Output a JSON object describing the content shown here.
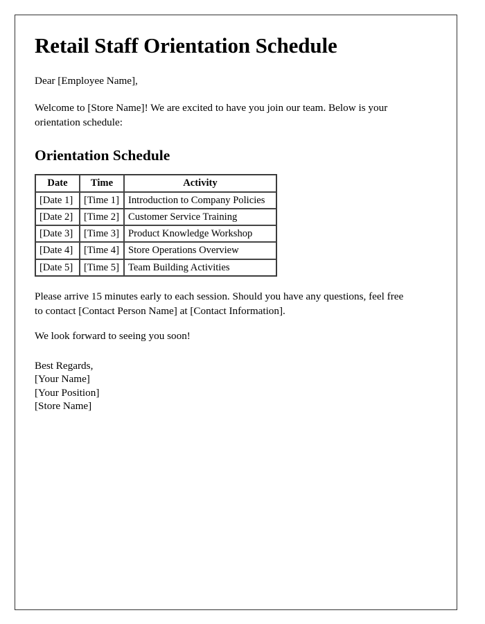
{
  "document": {
    "title": "Retail Staff Orientation Schedule",
    "salutation": "Dear [Employee Name],",
    "intro": "Welcome to [Store Name]! We are excited to have you join our team. Below is your orientation schedule:",
    "section_title": "Orientation Schedule",
    "note": "Please arrive 15 minutes early to each session. Should you have any questions, feel free to contact [Contact Person Name] at [Contact Information].",
    "closing": "We look forward to seeing you soon!",
    "signature": {
      "regards": "Best Regards,",
      "name": "[Your Name]",
      "position": "[Your Position]",
      "store": "[Store Name]"
    }
  },
  "schedule_table": {
    "headers": {
      "date": "Date",
      "time": "Time",
      "activity": "Activity"
    },
    "rows": [
      {
        "date": "[Date 1]",
        "time": "[Time 1]",
        "activity": "Introduction to Company Policies"
      },
      {
        "date": "[Date 2]",
        "time": "[Time 2]",
        "activity": "Customer Service Training"
      },
      {
        "date": "[Date 3]",
        "time": "[Time 3]",
        "activity": "Product Knowledge Workshop"
      },
      {
        "date": "[Date 4]",
        "time": "[Time 4]",
        "activity": "Store Operations Overview"
      },
      {
        "date": "[Date 5]",
        "time": "[Time 5]",
        "activity": "Team Building Activities"
      }
    ]
  },
  "colors": {
    "page_background": "#ffffff",
    "text": "#000000",
    "page_border": "#333333",
    "table_border": "#444444"
  }
}
